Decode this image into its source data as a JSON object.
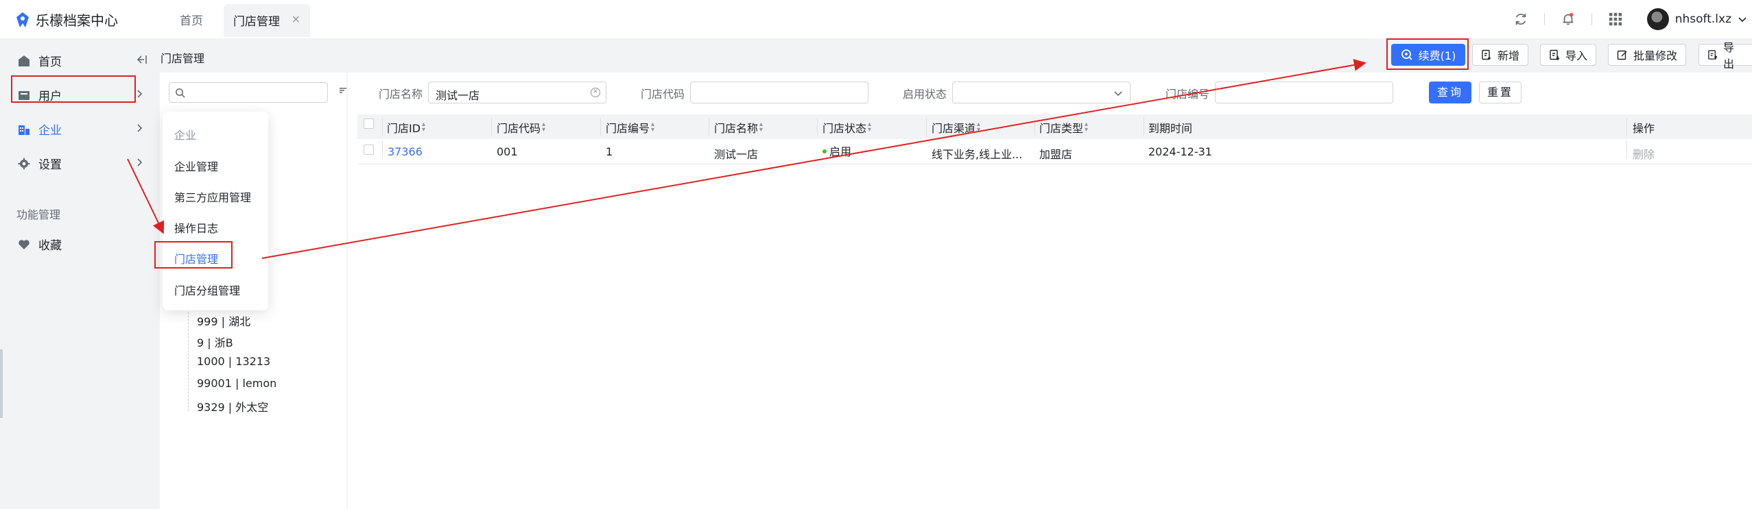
{
  "app": {
    "title": "乐檬档案中心"
  },
  "tabs": [
    {
      "label": "首页"
    },
    {
      "label": "门店管理",
      "close": "×"
    }
  ],
  "user": {
    "name": "nhsoft.lxz"
  },
  "sidebar": {
    "items": [
      {
        "label": "首页",
        "icon": "home-icon"
      },
      {
        "label": "用户",
        "icon": "user-card-icon"
      },
      {
        "label": "企业",
        "icon": "building-icon"
      },
      {
        "label": "设置",
        "icon": "gear-icon"
      }
    ],
    "section_label": "功能管理",
    "favorites": "收藏"
  },
  "breadcrumb": "门店管理",
  "popup_menu": {
    "header": "企业",
    "items": [
      "企业管理",
      "第三方应用管理",
      "操作日志",
      "门店管理",
      "门店分组管理"
    ],
    "active_index": 3
  },
  "tree": {
    "search_placeholder": "",
    "nodes": [
      "999 | 湖北",
      "9 | 浙B",
      "1000 | 13213",
      "99001 | lemon",
      "9329 | 外太空"
    ]
  },
  "filters": {
    "store_name": {
      "label": "门店名称",
      "value": "测试一店"
    },
    "store_code": {
      "label": "门店代码",
      "value": ""
    },
    "status": {
      "label": "启用状态",
      "value": ""
    },
    "store_number": {
      "label": "门店编号",
      "value": ""
    },
    "query_label": "查询",
    "reset_label": "重置"
  },
  "toolbar": {
    "renew_label": "续费(1)",
    "add_label": "新增",
    "import_label": "导入",
    "batch_edit_label": "批量修改",
    "export_label": "导出"
  },
  "table": {
    "columns": [
      "门店ID",
      "门店代码",
      "门店编号",
      "门店名称",
      "门店状态",
      "门店渠道",
      "门店类型",
      "到期时间",
      "操作"
    ],
    "rows": [
      {
        "id": "37366",
        "code": "001",
        "number": "1",
        "name": "测试一店",
        "status": "启用",
        "channel": "线下业务,线上业...",
        "type": "加盟店",
        "expire": "2024-12-31",
        "action": "删除"
      }
    ]
  },
  "colors": {
    "primary": "#3370ff",
    "annotation": "#e02020",
    "status_on": "#34c724"
  }
}
